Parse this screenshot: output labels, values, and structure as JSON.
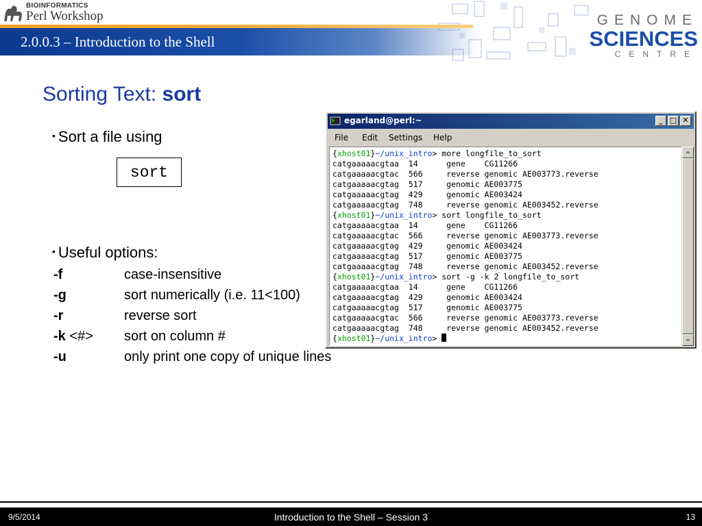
{
  "header": {
    "logo_top": "BIOINFORMATICS",
    "logo_bottom": "Perl Workshop",
    "section_title": "2.0.0.3 – Introduction to the Shell",
    "gsc_top": "GENOME",
    "gsc_mid": "SCIENCES",
    "gsc_bottom": "CENTRE"
  },
  "slide": {
    "title_plain": "Sorting Text: ",
    "title_bold": "sort",
    "bullet1": "Sort a file using",
    "code": "sort",
    "bullet2": "Useful options:",
    "options": [
      {
        "flag": "-f",
        "arg": "",
        "desc": "case-insensitive"
      },
      {
        "flag": "-g",
        "arg": "",
        "desc": "sort numerically (i.e. 11<100)"
      },
      {
        "flag": "-r",
        "arg": "",
        "desc": "reverse sort"
      },
      {
        "flag": "-k",
        "arg": " <#>",
        "desc": "sort on column #"
      },
      {
        "flag": "-u",
        "arg": "",
        "desc": "only print one copy of unique lines"
      }
    ]
  },
  "terminal": {
    "title": "egarland@perl:~",
    "menu": [
      "File",
      "Edit",
      "Settings",
      "Help"
    ],
    "prompt": {
      "open": "{",
      "host": "xhost01",
      "close": "}",
      "path": "~/unix_intro",
      "sep": "> "
    },
    "lines": [
      {
        "prompt": true,
        "text": "more longfile_to_sort"
      },
      {
        "text": "catgaaaaacgtaa  14      gene    CG11266"
      },
      {
        "text": "catgaaaaacgtac  566     reverse genomic AE003773.reverse"
      },
      {
        "text": "catgaaaaacgtag  517     genomic AE003775"
      },
      {
        "text": "catgaaaaacgtag  429     genomic AE003424"
      },
      {
        "text": "catgaaaaacgtag  748     reverse genomic AE003452.reverse"
      },
      {
        "prompt": true,
        "text": "sort longfile_to_sort"
      },
      {
        "text": "catgaaaaacgtaa  14      gene    CG11266"
      },
      {
        "text": "catgaaaaacgtac  566     reverse genomic AE003773.reverse"
      },
      {
        "text": "catgaaaaacgtag  429     genomic AE003424"
      },
      {
        "text": "catgaaaaacgtag  517     genomic AE003775"
      },
      {
        "text": "catgaaaaacgtag  748     reverse genomic AE003452.reverse"
      },
      {
        "prompt": true,
        "text": "sort -g -k 2 longfile_to_sort"
      },
      {
        "text": "catgaaaaacgtaa  14      gene    CG11266"
      },
      {
        "text": "catgaaaaacgtag  429     genomic AE003424"
      },
      {
        "text": "catgaaaaacgtag  517     genomic AE003775"
      },
      {
        "text": "catgaaaaacgtac  566     reverse genomic AE003773.reverse"
      },
      {
        "text": "catgaaaaacgtag  748     reverse genomic AE003452.reverse"
      },
      {
        "prompt": true,
        "text": "",
        "cursor": true
      }
    ]
  },
  "footer": {
    "date": "9/5/2014",
    "title": "Introduction to the Shell – Session 3",
    "page": "13"
  }
}
